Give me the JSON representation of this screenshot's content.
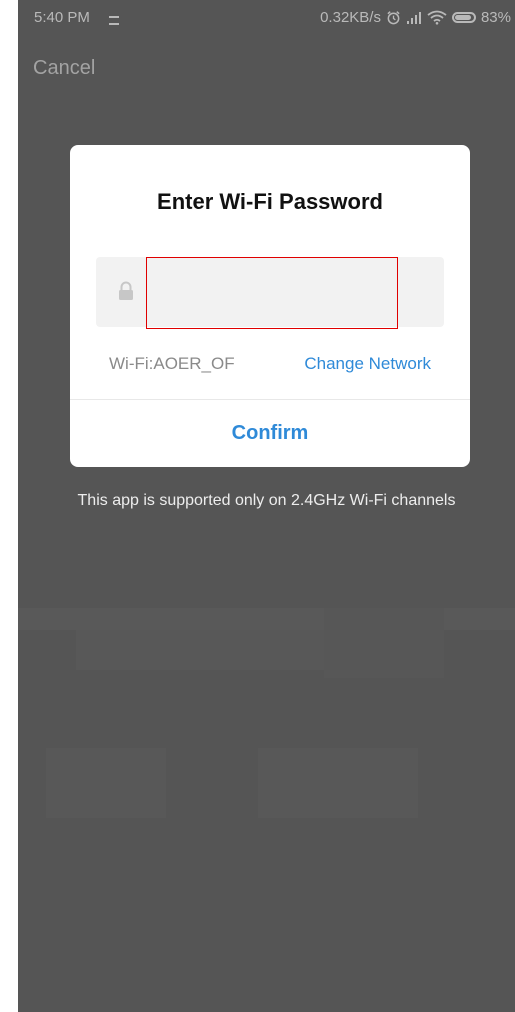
{
  "status_bar": {
    "time": "5:40 PM",
    "network_speed": "0.32KB/s",
    "battery_percent": "83%",
    "icons": [
      "message-icon",
      "alarm-icon",
      "signal-icon",
      "wifi-icon",
      "battery-icon"
    ]
  },
  "header": {
    "cancel_label": "Cancel"
  },
  "dialog": {
    "title": "Enter Wi-Fi Password",
    "password_value": "",
    "wifi_label": "Wi-Fi:AOER_OF",
    "change_network_label": "Change Network",
    "confirm_label": "Confirm"
  },
  "notice": "This app is supported only on 2.4GHz Wi-Fi channels",
  "colors": {
    "accent": "#2f8ad8",
    "overlay": "#555555",
    "highlight_border": "#e00000"
  }
}
